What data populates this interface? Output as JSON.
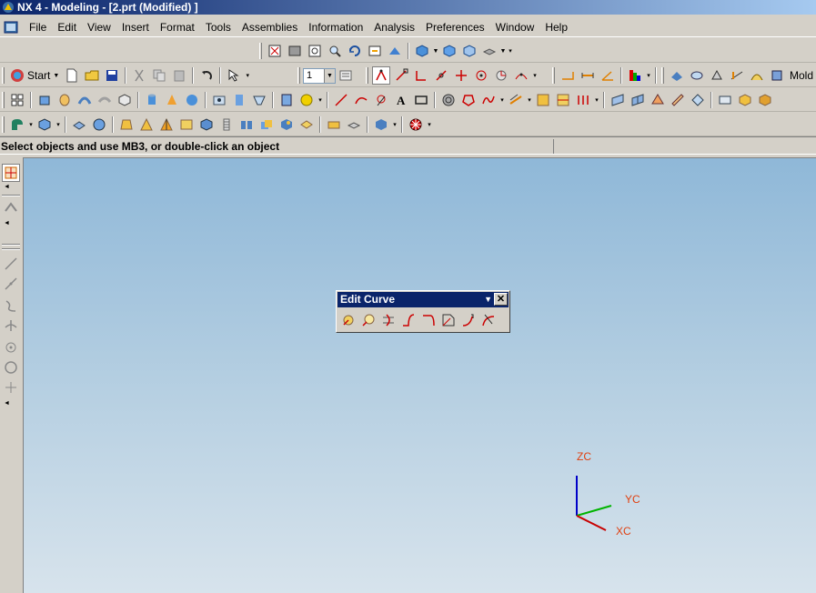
{
  "window": {
    "title": "NX 4 - Modeling - [2.prt (Modified) ]"
  },
  "menu": {
    "items": [
      {
        "label": "File",
        "name": "menu-file"
      },
      {
        "label": "Edit",
        "name": "menu-edit"
      },
      {
        "label": "View",
        "name": "menu-view"
      },
      {
        "label": "Insert",
        "name": "menu-insert"
      },
      {
        "label": "Format",
        "name": "menu-format"
      },
      {
        "label": "Tools",
        "name": "menu-tools"
      },
      {
        "label": "Assemblies",
        "name": "menu-assemblies"
      },
      {
        "label": "Information",
        "name": "menu-information"
      },
      {
        "label": "Analysis",
        "name": "menu-analysis"
      },
      {
        "label": "Preferences",
        "name": "menu-preferences"
      },
      {
        "label": "Window",
        "name": "menu-window"
      },
      {
        "label": "Help",
        "name": "menu-help"
      }
    ]
  },
  "toolbar": {
    "start_label": "Start",
    "layer_value": "1",
    "mold_label": "Mold"
  },
  "status": {
    "message": "Select objects and use MB3, or double-click an object"
  },
  "palette": {
    "title": "Edit Curve"
  },
  "triad": {
    "zc": "ZC",
    "yc": "YC",
    "xc": "XC"
  },
  "colors": {
    "titlebar_start": "#0a246a",
    "titlebar_end": "#a6caf0",
    "viewport_top": "#8fb8d8",
    "viewport_bottom": "#d7e3ec",
    "axis_z": "#0000c8",
    "axis_y": "#00b400",
    "axis_x": "#c80000",
    "axis_label": "#e04010"
  }
}
